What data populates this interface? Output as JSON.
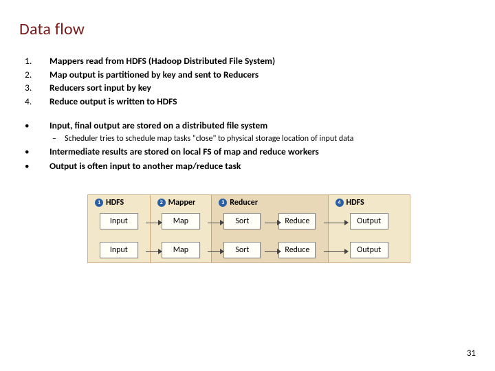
{
  "title": "Data flow",
  "numbered": [
    {
      "n": "1.",
      "text": "Mappers read from HDFS (Hadoop Distributed File System)"
    },
    {
      "n": "2.",
      "text": "Map output is partitioned by key and sent to Reducers"
    },
    {
      "n": "3.",
      "text": "Reducers sort input by key"
    },
    {
      "n": "4.",
      "text": "Reduce output is written to HDFS"
    }
  ],
  "bullets": {
    "b1": "Input, final output are stored on a distributed file system",
    "b1_sub": "Scheduler tries to schedule map tasks \"close\" to physical storage location of input data",
    "b2": "Intermediate results are stored on local FS of map and reduce workers",
    "b3": "Output is often input to another map/reduce task"
  },
  "diagram": {
    "headers": {
      "hdfs1": "HDFS",
      "mapper": "Mapper",
      "reducer": "Reducer",
      "hdfs2": "HDFS"
    },
    "nums": {
      "n1": "1",
      "n2": "2",
      "n3": "3",
      "n4": "4"
    },
    "boxes": {
      "input": "Input",
      "map": "Map",
      "sort": "Sort",
      "reduce": "Reduce",
      "output": "Output"
    }
  },
  "marks": {
    "bullet": "•",
    "dash": "–"
  },
  "page": "31"
}
